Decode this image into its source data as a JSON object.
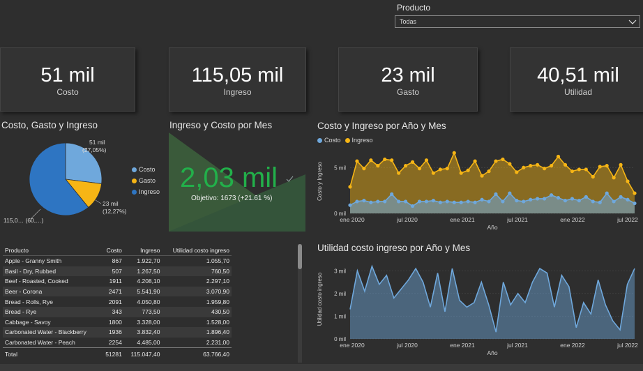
{
  "filter": {
    "label": "Producto",
    "value": "Todas"
  },
  "kpis": [
    {
      "value": "51 mil",
      "label": "Costo"
    },
    {
      "value": "115,05 mil",
      "label": "Ingreso"
    },
    {
      "value": "23 mil",
      "label": "Gasto"
    },
    {
      "value": "40,51 mil",
      "label": "Utilidad"
    }
  ],
  "pie": {
    "title": "Costo, Gasto y Ingreso",
    "legend": [
      "Costo",
      "Gasto",
      "Ingreso"
    ],
    "label_costo_1": "51 mil",
    "label_costo_2": "(27,05%)",
    "label_gasto_1": "23 mil",
    "label_gasto_2": "(12,27%)",
    "label_ingreso": "115,0… (60,…)"
  },
  "gauge": {
    "title": "Ingreso y Costo por Mes",
    "value": "2,03 mil",
    "target": "Objetivo: 1673 (+21.61 %)"
  },
  "table": {
    "headers": [
      "Producto",
      "Costo",
      "Ingreso",
      "Utilidad costo ingreso"
    ],
    "rows": [
      [
        "Apple - Granny Smith",
        "867",
        "1.922,70",
        "1.055,70"
      ],
      [
        "Basil - Dry, Rubbed",
        "507",
        "1.267,50",
        "760,50"
      ],
      [
        "Beef - Roasted, Cooked",
        "1911",
        "4.208,10",
        "2.297,10"
      ],
      [
        "Beer - Corona",
        "2471",
        "5.541,90",
        "3.070,90"
      ],
      [
        "Bread - Rolls, Rye",
        "2091",
        "4.050,80",
        "1.959,80"
      ],
      [
        "Bread - Rye",
        "343",
        "773,50",
        "430,50"
      ],
      [
        "Cabbage - Savoy",
        "1800",
        "3.328,00",
        "1.528,00"
      ],
      [
        "Carbonated Water - Blackberry",
        "1936",
        "3.832,40",
        "1.896,40"
      ],
      [
        "Carbonated Water - Peach",
        "2254",
        "4.485,00",
        "2.231,00"
      ]
    ],
    "total": [
      "Total",
      "51281",
      "115.047,40",
      "63.766,40"
    ]
  },
  "colors": {
    "costo": "#6fa8dc",
    "gasto": "#f6b515",
    "ingreso": "#2e75c2",
    "gauge": "#3a5a3a",
    "gauge_value": "#22b04a"
  },
  "chart_data": [
    {
      "type": "pie",
      "title": "Costo, Gasto y Ingreso",
      "categories": [
        "Costo",
        "Gasto",
        "Ingreso"
      ],
      "values": [
        51,
        23,
        115.05
      ],
      "percent": [
        27.05,
        12.27,
        60.68
      ]
    },
    {
      "type": "area",
      "title": "Costo y Ingreso por Año y Mes",
      "xlabel": "Año",
      "ylabel": "Costo y Ingreso",
      "x_ticks": [
        "ene 2020",
        "jul 2020",
        "ene 2021",
        "jul 2021",
        "ene 2022",
        "jul 2022"
      ],
      "y_ticks": [
        "0 mil",
        "5 mil"
      ],
      "ylim": [
        0,
        7
      ],
      "series": [
        {
          "name": "Ingreso",
          "values": [
            2.9,
            5.7,
            4.9,
            5.8,
            5.2,
            5.9,
            5.8,
            4.4,
            5.2,
            5.6,
            4.9,
            5.8,
            4.4,
            4.8,
            4.9,
            6.6,
            4.4,
            4.7,
            5.7,
            4.1,
            4.6,
            5.7,
            5.9,
            5.4,
            4.5,
            5.0,
            5.2,
            5.3,
            4.9,
            5.2,
            6.2,
            5.3,
            4.6,
            4.8,
            4.8,
            4.0,
            5.1,
            5.2,
            3.9,
            5.3,
            3.5,
            2.2
          ]
        },
        {
          "name": "Costo",
          "values": [
            0.9,
            1.3,
            1.4,
            1.2,
            1.3,
            1.3,
            2.1,
            1.3,
            1.3,
            0.8,
            1.3,
            1.3,
            1.4,
            1.2,
            1.3,
            1.2,
            1.2,
            1.3,
            1.2,
            1.5,
            1.3,
            2.1,
            1.3,
            2.2,
            1.4,
            1.3,
            1.5,
            1.6,
            1.6,
            2.0,
            1.7,
            1.4,
            1.6,
            1.4,
            1.8,
            1.3,
            1.2,
            2.2,
            1.3,
            1.8,
            1.5,
            1.1
          ]
        }
      ]
    },
    {
      "type": "area",
      "title": "Utilidad costo ingreso por Año y Mes",
      "xlabel": "Año",
      "ylabel": "Utilidad costo ingreso",
      "x_ticks": [
        "ene 2020",
        "jul 2020",
        "ene 2021",
        "jul 2021",
        "ene 2022",
        "jul 2022"
      ],
      "y_ticks": [
        "0 mil",
        "1 mil",
        "2 mil",
        "3 mil"
      ],
      "ylim": [
        0,
        3.5
      ],
      "series": [
        {
          "name": "Utilidad costo ingreso",
          "values": [
            1.3,
            3.0,
            2.1,
            3.2,
            2.4,
            2.8,
            1.8,
            2.2,
            2.6,
            3.1,
            2.5,
            1.4,
            2.9,
            1.2,
            3.1,
            1.7,
            1.4,
            1.6,
            2.5,
            1.5,
            0.3,
            2.5,
            1.5,
            2.0,
            1.6,
            2.5,
            3.1,
            2.9,
            1.4,
            2.8,
            2.3,
            0.5,
            1.6,
            1.1,
            2.6,
            1.5,
            0.8,
            0.4,
            2.4,
            3.1
          ]
        }
      ]
    }
  ]
}
